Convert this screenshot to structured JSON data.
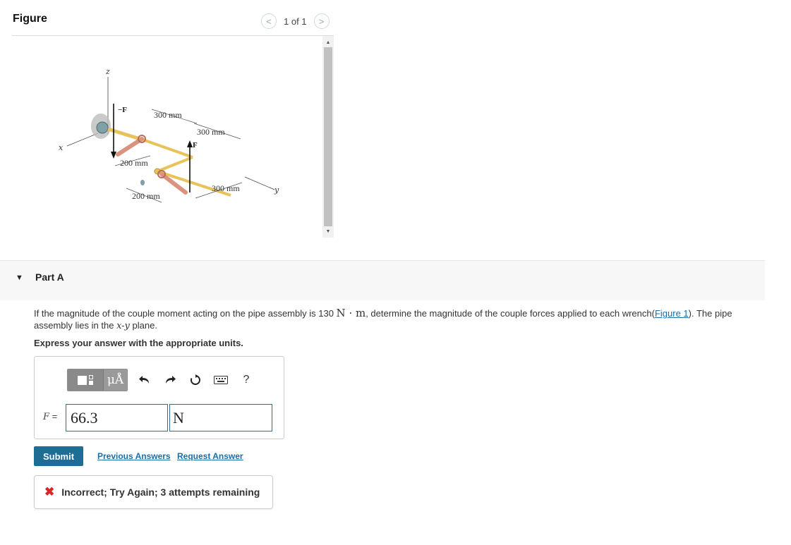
{
  "figure": {
    "title": "Figure",
    "pager_text": "1 of 1",
    "prev_icon": "<",
    "next_icon": ">",
    "labels": {
      "z": "z",
      "x": "x",
      "y": "y",
      "neg_f": "−F",
      "f": "F",
      "dim_300_top": "300 mm",
      "dim_300_mid": "300 mm",
      "dim_300_low": "300 mm",
      "dim_200_a": "200 mm",
      "dim_200_b": "200 mm"
    }
  },
  "part": {
    "caret": "▼",
    "title": "Part A"
  },
  "problem": {
    "text_before": "If the magnitude of the couple moment acting on the pipe assembly is 130 ",
    "unit_moment": "N · m",
    "text_mid": ", determine the magnitude of the couple forces applied to each wrench(",
    "figure_link": "Figure 1",
    "text_after": "). The pipe assembly lies in the ",
    "plane": "x-y",
    "text_end": " plane.",
    "instruction": "Express your answer with the appropriate units."
  },
  "answer": {
    "units_symbol": "μÅ",
    "help_symbol": "?",
    "var_label": "F",
    "equals": " =",
    "value": "66.3",
    "unit": "N"
  },
  "actions": {
    "submit": "Submit",
    "previous_answers": "Previous Answers",
    "request_answer": "Request Answer"
  },
  "feedback": {
    "text": "Incorrect; Try Again; 3 attempts remaining"
  }
}
